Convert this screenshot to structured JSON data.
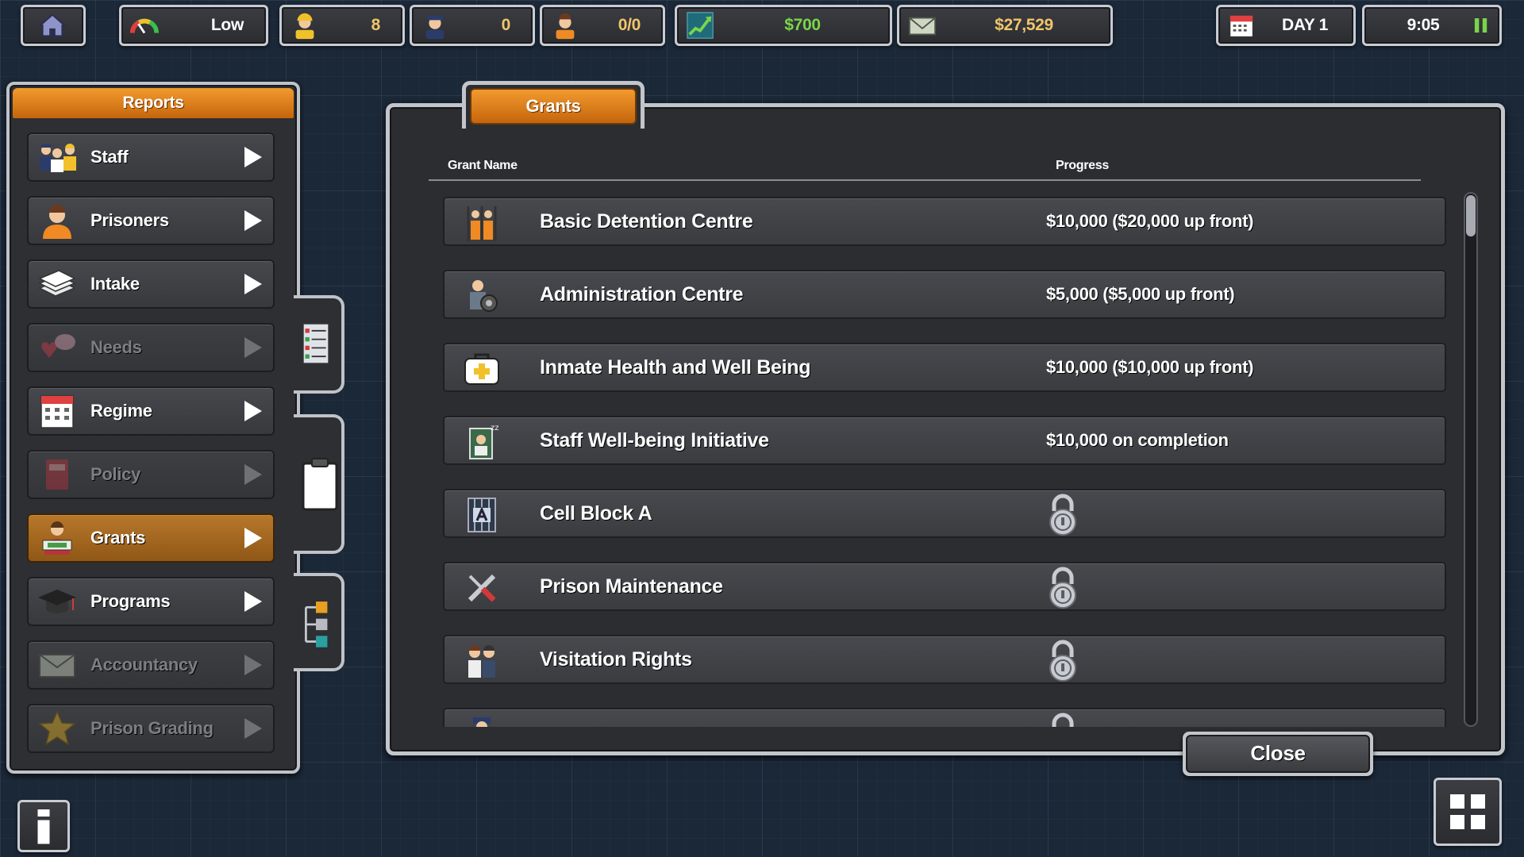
{
  "topbar": {
    "danger_level": "Low",
    "staff_count": "8",
    "guards_count": "0",
    "prisoners_count": "0/0",
    "income": "$700",
    "balance": "$27,529",
    "day": "DAY 1",
    "time": "9:05"
  },
  "reports": {
    "title": "Reports",
    "items": [
      {
        "label": "Staff",
        "icon": "staff-icon",
        "state": "enabled"
      },
      {
        "label": "Prisoners",
        "icon": "prisoner-icon",
        "state": "enabled"
      },
      {
        "label": "Intake",
        "icon": "intake-icon",
        "state": "enabled"
      },
      {
        "label": "Needs",
        "icon": "needs-icon",
        "state": "disabled"
      },
      {
        "label": "Regime",
        "icon": "calendar-icon",
        "state": "enabled"
      },
      {
        "label": "Policy",
        "icon": "policy-book-icon",
        "state": "disabled"
      },
      {
        "label": "Grants",
        "icon": "grants-icon",
        "state": "active"
      },
      {
        "label": "Programs",
        "icon": "graduation-cap-icon",
        "state": "enabled"
      },
      {
        "label": "Accountancy",
        "icon": "money-envelope-icon",
        "state": "disabled"
      },
      {
        "label": "Prison Grading",
        "icon": "star-icon",
        "state": "disabled"
      }
    ]
  },
  "grants": {
    "tab_label": "Grants",
    "col_name": "Grant Name",
    "col_progress": "Progress",
    "rows": [
      {
        "name": "Basic Detention Centre",
        "progress": "$10,000 ($20,000 up front)",
        "locked": false,
        "icon": "prison-bars-icon"
      },
      {
        "name": "Administration Centre",
        "progress": "$5,000 ($5,000 up front)",
        "locked": false,
        "icon": "admin-gear-icon"
      },
      {
        "name": "Inmate Health and Well Being",
        "progress": "$10,000 ($10,000 up front)",
        "locked": false,
        "icon": "medical-kit-icon"
      },
      {
        "name": "Staff Well-being Initiative",
        "progress": "$10,000 on completion",
        "locked": false,
        "icon": "staff-room-icon"
      },
      {
        "name": "Cell Block A",
        "progress": "",
        "locked": true,
        "icon": "cell-block-icon"
      },
      {
        "name": "Prison Maintenance",
        "progress": "",
        "locked": true,
        "icon": "tools-icon"
      },
      {
        "name": "Visitation Rights",
        "progress": "",
        "locked": true,
        "icon": "visitors-icon"
      }
    ],
    "close_label": "Close"
  },
  "colors": {
    "accent_orange": "#e58a22",
    "income_green": "#7bd44a",
    "money_gold": "#f1c56b",
    "panel_bg": "#2b2d31",
    "frame": "#c2c6cb"
  }
}
